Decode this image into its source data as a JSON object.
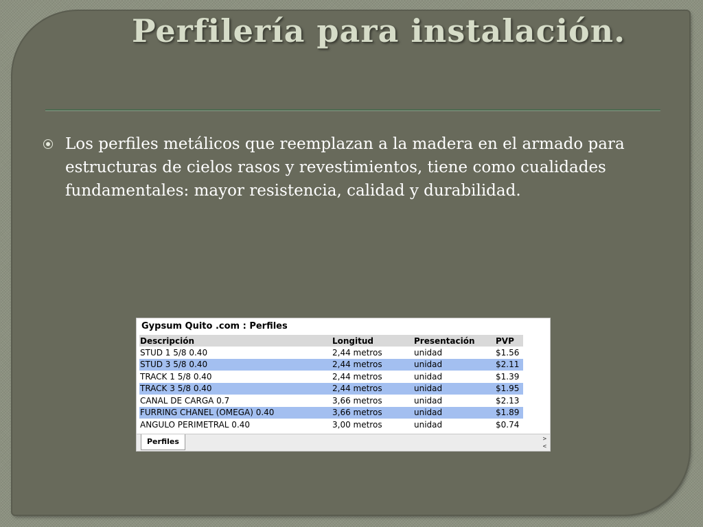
{
  "slide": {
    "title": "Perfilería para instalación.",
    "bullet_text": "Los perfiles metálicos que reemplazan a la madera en el armado para estructuras de cielos rasos y revestimientos, tiene como cualidades fundamentales: mayor resistencia, calidad y durabilidad."
  },
  "sheet": {
    "title": "Gypsum Quito .com : Perfiles",
    "columns": [
      "Descripción",
      "Longitud",
      "Presentación",
      "PVP"
    ],
    "rows": [
      [
        "STUD 1 5/8 0.40",
        "2,44 metros",
        "unidad",
        "$1.56"
      ],
      [
        "STUD 3 5/8 0.40",
        "2,44 metros",
        "unidad",
        "$2.11"
      ],
      [
        "TRACK 1 5/8 0.40",
        "2,44 metros",
        "unidad",
        "$1.39"
      ],
      [
        "TRACK 3 5/8 0.40",
        "2,44 metros",
        "unidad",
        "$1.95"
      ],
      [
        "CANAL DE CARGA 0.7",
        "3,66 metros",
        "unidad",
        "$2.13"
      ],
      [
        "FURRING CHANEL (OMEGA) 0.40",
        "3,66 metros",
        "unidad",
        "$1.89"
      ],
      [
        "ANGULO PERIMETRAL 0.40",
        "3,00 metros",
        "unidad",
        "$0.74"
      ]
    ],
    "tab_label": "Perfiles",
    "scroll_next": ">",
    "scroll_prev": "<"
  },
  "colors": {
    "panel": "#686a5b",
    "title": "#d6dcc8",
    "row_highlight": "#a3bff0"
  },
  "icons": {
    "bullet": "bullet-circle-icon"
  }
}
